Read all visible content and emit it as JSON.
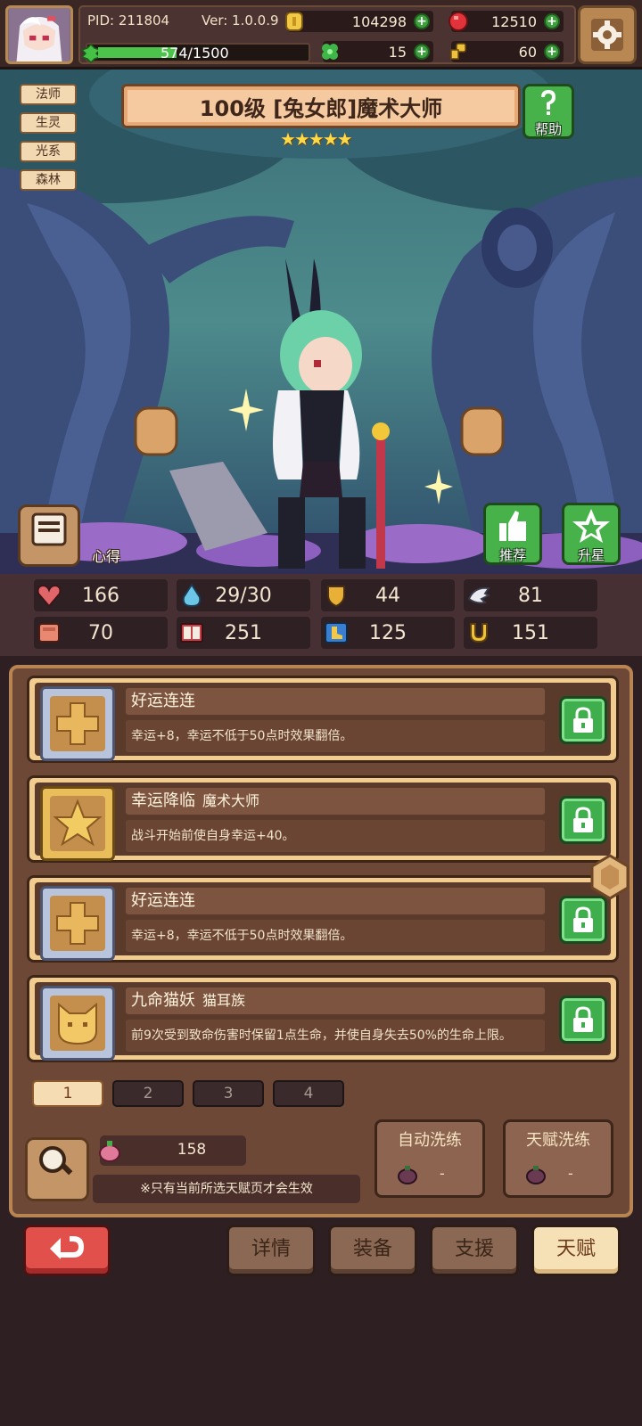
{
  "header": {
    "pid": "PID: 211804",
    "version": "Ver: 1.0.0.9",
    "gold": "104298",
    "gems": "12510",
    "clover": "15",
    "key": "60",
    "xp_text": "574/1500",
    "xp_progress": 0.383
  },
  "hero": {
    "title": "100级 [兔女郎]魔术大师",
    "stars": "★★★★★",
    "tags": [
      "法师",
      "生灵",
      "光系",
      "森林"
    ],
    "help_label": "帮助",
    "experience_label": "心得",
    "recommend_label": "推荐",
    "star_up_label": "升星"
  },
  "stats": {
    "hp": "166",
    "mana": "29/30",
    "defense": "44",
    "speed": "81",
    "attack": "70",
    "magic": "251",
    "agility": "125",
    "luck": "151"
  },
  "talents": [
    {
      "name": "好运连连",
      "sub": "",
      "desc": "幸运+8，幸运不低于50点时效果翻倍。",
      "icon": "cross-icon",
      "frame": "silver"
    },
    {
      "name": "幸运降临",
      "sub": "魔术大师",
      "desc": "战斗开始前使自身幸运+40。",
      "icon": "star-icon",
      "frame": "gold"
    },
    {
      "name": "好运连连",
      "sub": "",
      "desc": "幸运+8，幸运不低于50点时效果翻倍。",
      "icon": "cross-icon",
      "frame": "silver"
    },
    {
      "name": "九命猫妖",
      "sub": "猫耳族",
      "desc": "前9次受到致命伤害时保留1点生命，并使自身失去50%的生命上限。",
      "icon": "cat-icon",
      "frame": "silver"
    }
  ],
  "pages": [
    "1",
    "2",
    "3",
    "4"
  ],
  "bottom": {
    "view_label": "查看",
    "fruit_count": "158",
    "notice": "※只有当前所选天赋页才会生效",
    "auto_wash_label": "自动洗练",
    "auto_wash_value": "-",
    "talent_wash_label": "天赋洗练",
    "talent_wash_value": "-"
  },
  "nav": {
    "details": "详情",
    "equipment": "装备",
    "support": "支援",
    "talent": "天赋"
  }
}
